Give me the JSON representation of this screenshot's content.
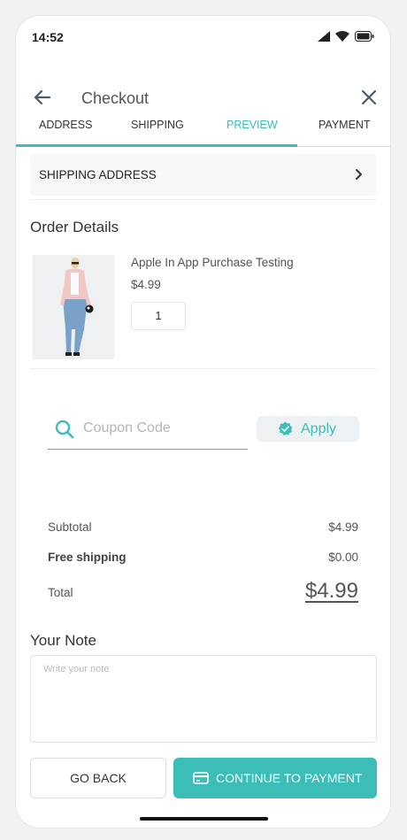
{
  "status_bar": {
    "time": "14:52"
  },
  "header": {
    "title": "Checkout"
  },
  "tabs": [
    {
      "label": "ADDRESS"
    },
    {
      "label": "SHIPPING"
    },
    {
      "label": "PREVIEW"
    },
    {
      "label": "PAYMENT"
    }
  ],
  "shipping_address": {
    "label": "SHIPPING ADDRESS"
  },
  "order": {
    "title": "Order Details",
    "product": {
      "name": "Apple In App Purchase Testing",
      "price": "$4.99",
      "quantity": "1"
    }
  },
  "coupon": {
    "placeholder": "Coupon Code",
    "apply_label": "Apply"
  },
  "summary": {
    "subtotal_label": "Subtotal",
    "subtotal_value": "$4.99",
    "shipping_label": "Free shipping",
    "shipping_value": "$0.00",
    "total_label": "Total",
    "total_value": "$4.99"
  },
  "note": {
    "title": "Your Note",
    "placeholder": "Write your note"
  },
  "buttons": {
    "go_back": "GO BACK",
    "continue": "CONTINUE TO PAYMENT"
  },
  "colors": {
    "accent": "#3dbdb7"
  }
}
